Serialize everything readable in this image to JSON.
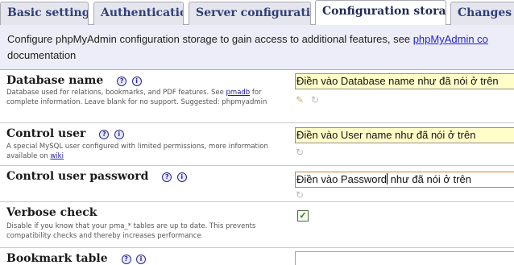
{
  "tabs": [
    {
      "label": "Basic settings"
    },
    {
      "label": "Authentication"
    },
    {
      "label": "Server configuration"
    },
    {
      "label": "Configuration storage"
    },
    {
      "label": "Changes tr"
    }
  ],
  "active_tab": "Configuration storage",
  "description": {
    "text": "Configure phpMyAdmin configuration storage to gain access to additional features, see",
    "link": "phpMyAdmin co",
    "line2": "documentation"
  },
  "rows": {
    "database_name": {
      "label": "Database name",
      "help_before": "Database used for relations, bookmarks, and PDF features. See",
      "help_link": "pmadb",
      "help_after": "for complete information. Leave blank for no support. Suggested: phpmyadmin",
      "value": "Điền vào Database name như đã nói ở trên"
    },
    "control_user": {
      "label": "Control user",
      "help_before": "A special MySQL user configured with limited permissions, more information available on",
      "help_link": "wiki",
      "value": "Điền vào User name như đã nói ở trên"
    },
    "control_user_password": {
      "label": "Control user password",
      "value_before_caret": "Điền vào Password",
      "value_after_caret": " như đã nói ở trên"
    },
    "verbose_check": {
      "label": "Verbose check",
      "help": "Disable if you know that your pma_* tables are up to date. This prevents compatibility checks and thereby increases performance",
      "checked": true
    },
    "bookmark_table": {
      "label": "Bookmark table",
      "value": ""
    }
  },
  "icons": {
    "help": "question-mark-icon",
    "docs": "info-icon",
    "restore": "restore-default-icon",
    "edit": "pencil-icon"
  },
  "colors": {
    "tab_text": "#2f3f78",
    "tab_bg": "#e5e5ee",
    "desc_bg": "#ededf9",
    "input_bg": "#fffdc8",
    "focus_border": "#d27d2e",
    "link": "#2323c8"
  }
}
